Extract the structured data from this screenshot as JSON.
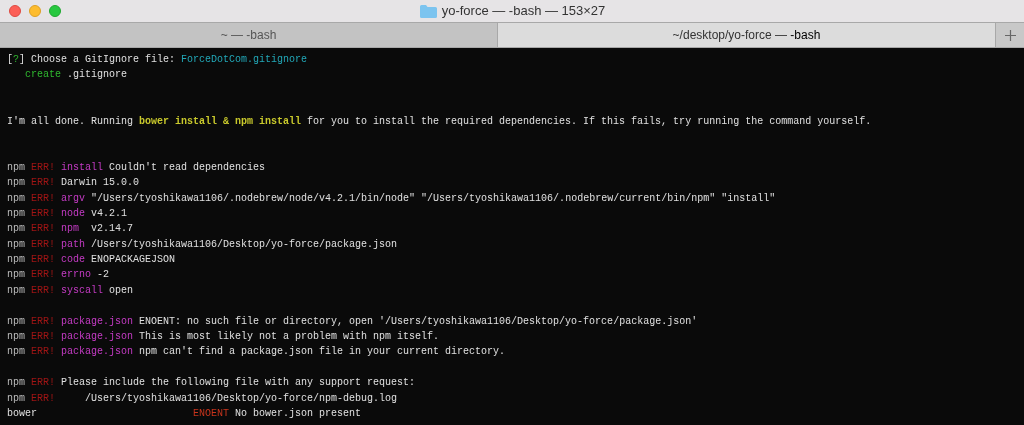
{
  "window": {
    "title": "yo-force — -bash — 153×27"
  },
  "tabs": [
    {
      "label": "~ — -bash",
      "selected": false
    },
    {
      "label": "~/desktop/yo-force — ",
      "bold_part": "-bash",
      "selected": true
    }
  ],
  "terminal": {
    "lines": [
      {
        "kind": "text",
        "segments": [
          {
            "text": "[",
            "kind": "plain"
          },
          {
            "text": "?",
            "kind": "success"
          },
          {
            "text": "] Choose a GitIgnore file: ",
            "kind": "plain"
          },
          {
            "text": "ForceDotCom.gitignore",
            "kind": "answer"
          }
        ]
      },
      {
        "kind": "text",
        "segments": [
          {
            "text": "   create",
            "kind": "success"
          },
          {
            "text": " .gitignore",
            "kind": "plain"
          }
        ]
      },
      {
        "kind": "blank"
      },
      {
        "kind": "blank"
      },
      {
        "kind": "text",
        "segments": [
          {
            "text": "I'm all done. Running ",
            "kind": "plain"
          },
          {
            "text": "bower install & npm install",
            "kind": "highlight"
          },
          {
            "text": " for you to install the required dependencies. If this fails, try running the command yourself.",
            "kind": "plain"
          }
        ]
      },
      {
        "kind": "blank"
      },
      {
        "kind": "blank"
      },
      {
        "kind": "text",
        "segments": [
          {
            "text": "npm ",
            "kind": "dim"
          },
          {
            "text": "ERR!",
            "kind": "error"
          },
          {
            "text": " install",
            "kind": "keyword"
          },
          {
            "text": " Couldn't read dependencies",
            "kind": "plain"
          }
        ]
      },
      {
        "kind": "text",
        "segments": [
          {
            "text": "npm ",
            "kind": "dim"
          },
          {
            "text": "ERR!",
            "kind": "error"
          },
          {
            "text": " Darwin 15.0.0",
            "kind": "plain"
          }
        ]
      },
      {
        "kind": "text",
        "segments": [
          {
            "text": "npm ",
            "kind": "dim"
          },
          {
            "text": "ERR!",
            "kind": "error"
          },
          {
            "text": " argv",
            "kind": "keyword"
          },
          {
            "text": " \"/Users/tyoshikawa1106/.nodebrew/node/v4.2.1/bin/node\" \"/Users/tyoshikawa1106/.nodebrew/current/bin/npm\" \"install\"",
            "kind": "plain"
          }
        ]
      },
      {
        "kind": "text",
        "segments": [
          {
            "text": "npm ",
            "kind": "dim"
          },
          {
            "text": "ERR!",
            "kind": "error"
          },
          {
            "text": " node",
            "kind": "keyword"
          },
          {
            "text": " v4.2.1",
            "kind": "plain"
          }
        ]
      },
      {
        "kind": "text",
        "segments": [
          {
            "text": "npm ",
            "kind": "dim"
          },
          {
            "text": "ERR!",
            "kind": "error"
          },
          {
            "text": " npm",
            "kind": "keyword"
          },
          {
            "text": "  v2.14.7",
            "kind": "plain"
          }
        ]
      },
      {
        "kind": "text",
        "segments": [
          {
            "text": "npm ",
            "kind": "dim"
          },
          {
            "text": "ERR!",
            "kind": "error"
          },
          {
            "text": " path",
            "kind": "keyword"
          },
          {
            "text": " /Users/tyoshikawa1106/Desktop/yo-force/package.json",
            "kind": "plain"
          }
        ]
      },
      {
        "kind": "text",
        "segments": [
          {
            "text": "npm ",
            "kind": "dim"
          },
          {
            "text": "ERR!",
            "kind": "error"
          },
          {
            "text": " code",
            "kind": "keyword"
          },
          {
            "text": " ENOPACKAGEJSON",
            "kind": "plain"
          }
        ]
      },
      {
        "kind": "text",
        "segments": [
          {
            "text": "npm ",
            "kind": "dim"
          },
          {
            "text": "ERR!",
            "kind": "error"
          },
          {
            "text": " errno",
            "kind": "keyword"
          },
          {
            "text": " -2",
            "kind": "plain"
          }
        ]
      },
      {
        "kind": "text",
        "segments": [
          {
            "text": "npm ",
            "kind": "dim"
          },
          {
            "text": "ERR!",
            "kind": "error"
          },
          {
            "text": " syscall",
            "kind": "keyword"
          },
          {
            "text": " open",
            "kind": "plain"
          }
        ]
      },
      {
        "kind": "blank"
      },
      {
        "kind": "text",
        "segments": [
          {
            "text": "npm ",
            "kind": "dim"
          },
          {
            "text": "ERR!",
            "kind": "error"
          },
          {
            "text": " package.json",
            "kind": "keyword"
          },
          {
            "text": " ENOENT: no such file or directory, open '/Users/tyoshikawa1106/Desktop/yo-force/package.json'",
            "kind": "plain"
          }
        ]
      },
      {
        "kind": "text",
        "segments": [
          {
            "text": "npm ",
            "kind": "dim"
          },
          {
            "text": "ERR!",
            "kind": "error"
          },
          {
            "text": " package.json",
            "kind": "keyword"
          },
          {
            "text": " This is most likely not a problem with npm itself.",
            "kind": "plain"
          }
        ]
      },
      {
        "kind": "text",
        "segments": [
          {
            "text": "npm ",
            "kind": "dim"
          },
          {
            "text": "ERR!",
            "kind": "error"
          },
          {
            "text": " package.json",
            "kind": "keyword"
          },
          {
            "text": " npm can't find a package.json file in your current directory.",
            "kind": "plain"
          }
        ]
      },
      {
        "kind": "blank"
      },
      {
        "kind": "text",
        "segments": [
          {
            "text": "npm ",
            "kind": "dim"
          },
          {
            "text": "ERR!",
            "kind": "error"
          },
          {
            "text": " Please include the following file with any support request:",
            "kind": "plain"
          }
        ]
      },
      {
        "kind": "text",
        "segments": [
          {
            "text": "npm ",
            "kind": "dim"
          },
          {
            "text": "ERR!",
            "kind": "error"
          },
          {
            "text": "     /Users/tyoshikawa1106/Desktop/yo-force/npm-debug.log",
            "kind": "plain"
          }
        ]
      },
      {
        "kind": "text",
        "segments": [
          {
            "text": "bower                          ",
            "kind": "plain"
          },
          {
            "text": "ENOENT",
            "kind": "warning"
          },
          {
            "text": " No bower.json present",
            "kind": "plain"
          }
        ]
      }
    ]
  }
}
